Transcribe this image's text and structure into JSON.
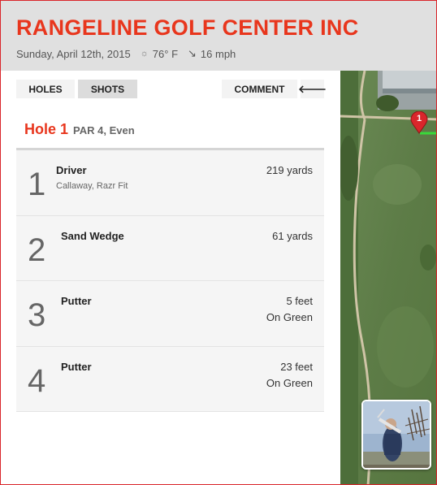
{
  "course": {
    "name": "RANGELINE GOLF CENTER INC",
    "date": "Sunday, April 12th, 2015",
    "temperature": "76° F",
    "wind": "16 mph",
    "icons": {
      "weather": "sun-icon",
      "wind": "wind-arrow-icon"
    }
  },
  "tabs": {
    "holes": "HOLES",
    "shots": "SHOTS",
    "comment": "COMMENT",
    "active": "shots",
    "back_icon": "arrow-left-icon"
  },
  "hole": {
    "name": "Hole 1",
    "summary": "PAR 4, Even"
  },
  "shots": [
    {
      "number": "1",
      "club": "Driver",
      "detail": "Callaway, Razr Fit",
      "distance": "219 yards",
      "lie": ""
    },
    {
      "number": "2",
      "club": "Sand Wedge",
      "detail": "",
      "distance": "61 yards",
      "lie": ""
    },
    {
      "number": "3",
      "club": "Putter",
      "detail": "",
      "distance": "5 feet",
      "lie": "On Green"
    },
    {
      "number": "4",
      "club": "Putter",
      "detail": "",
      "distance": "23 feet",
      "lie": "On Green"
    }
  ],
  "map": {
    "marker_label": "1",
    "colors": {
      "accent": "#e8361d",
      "marker": "#d9262b",
      "tee_line": "#39d93a"
    }
  }
}
